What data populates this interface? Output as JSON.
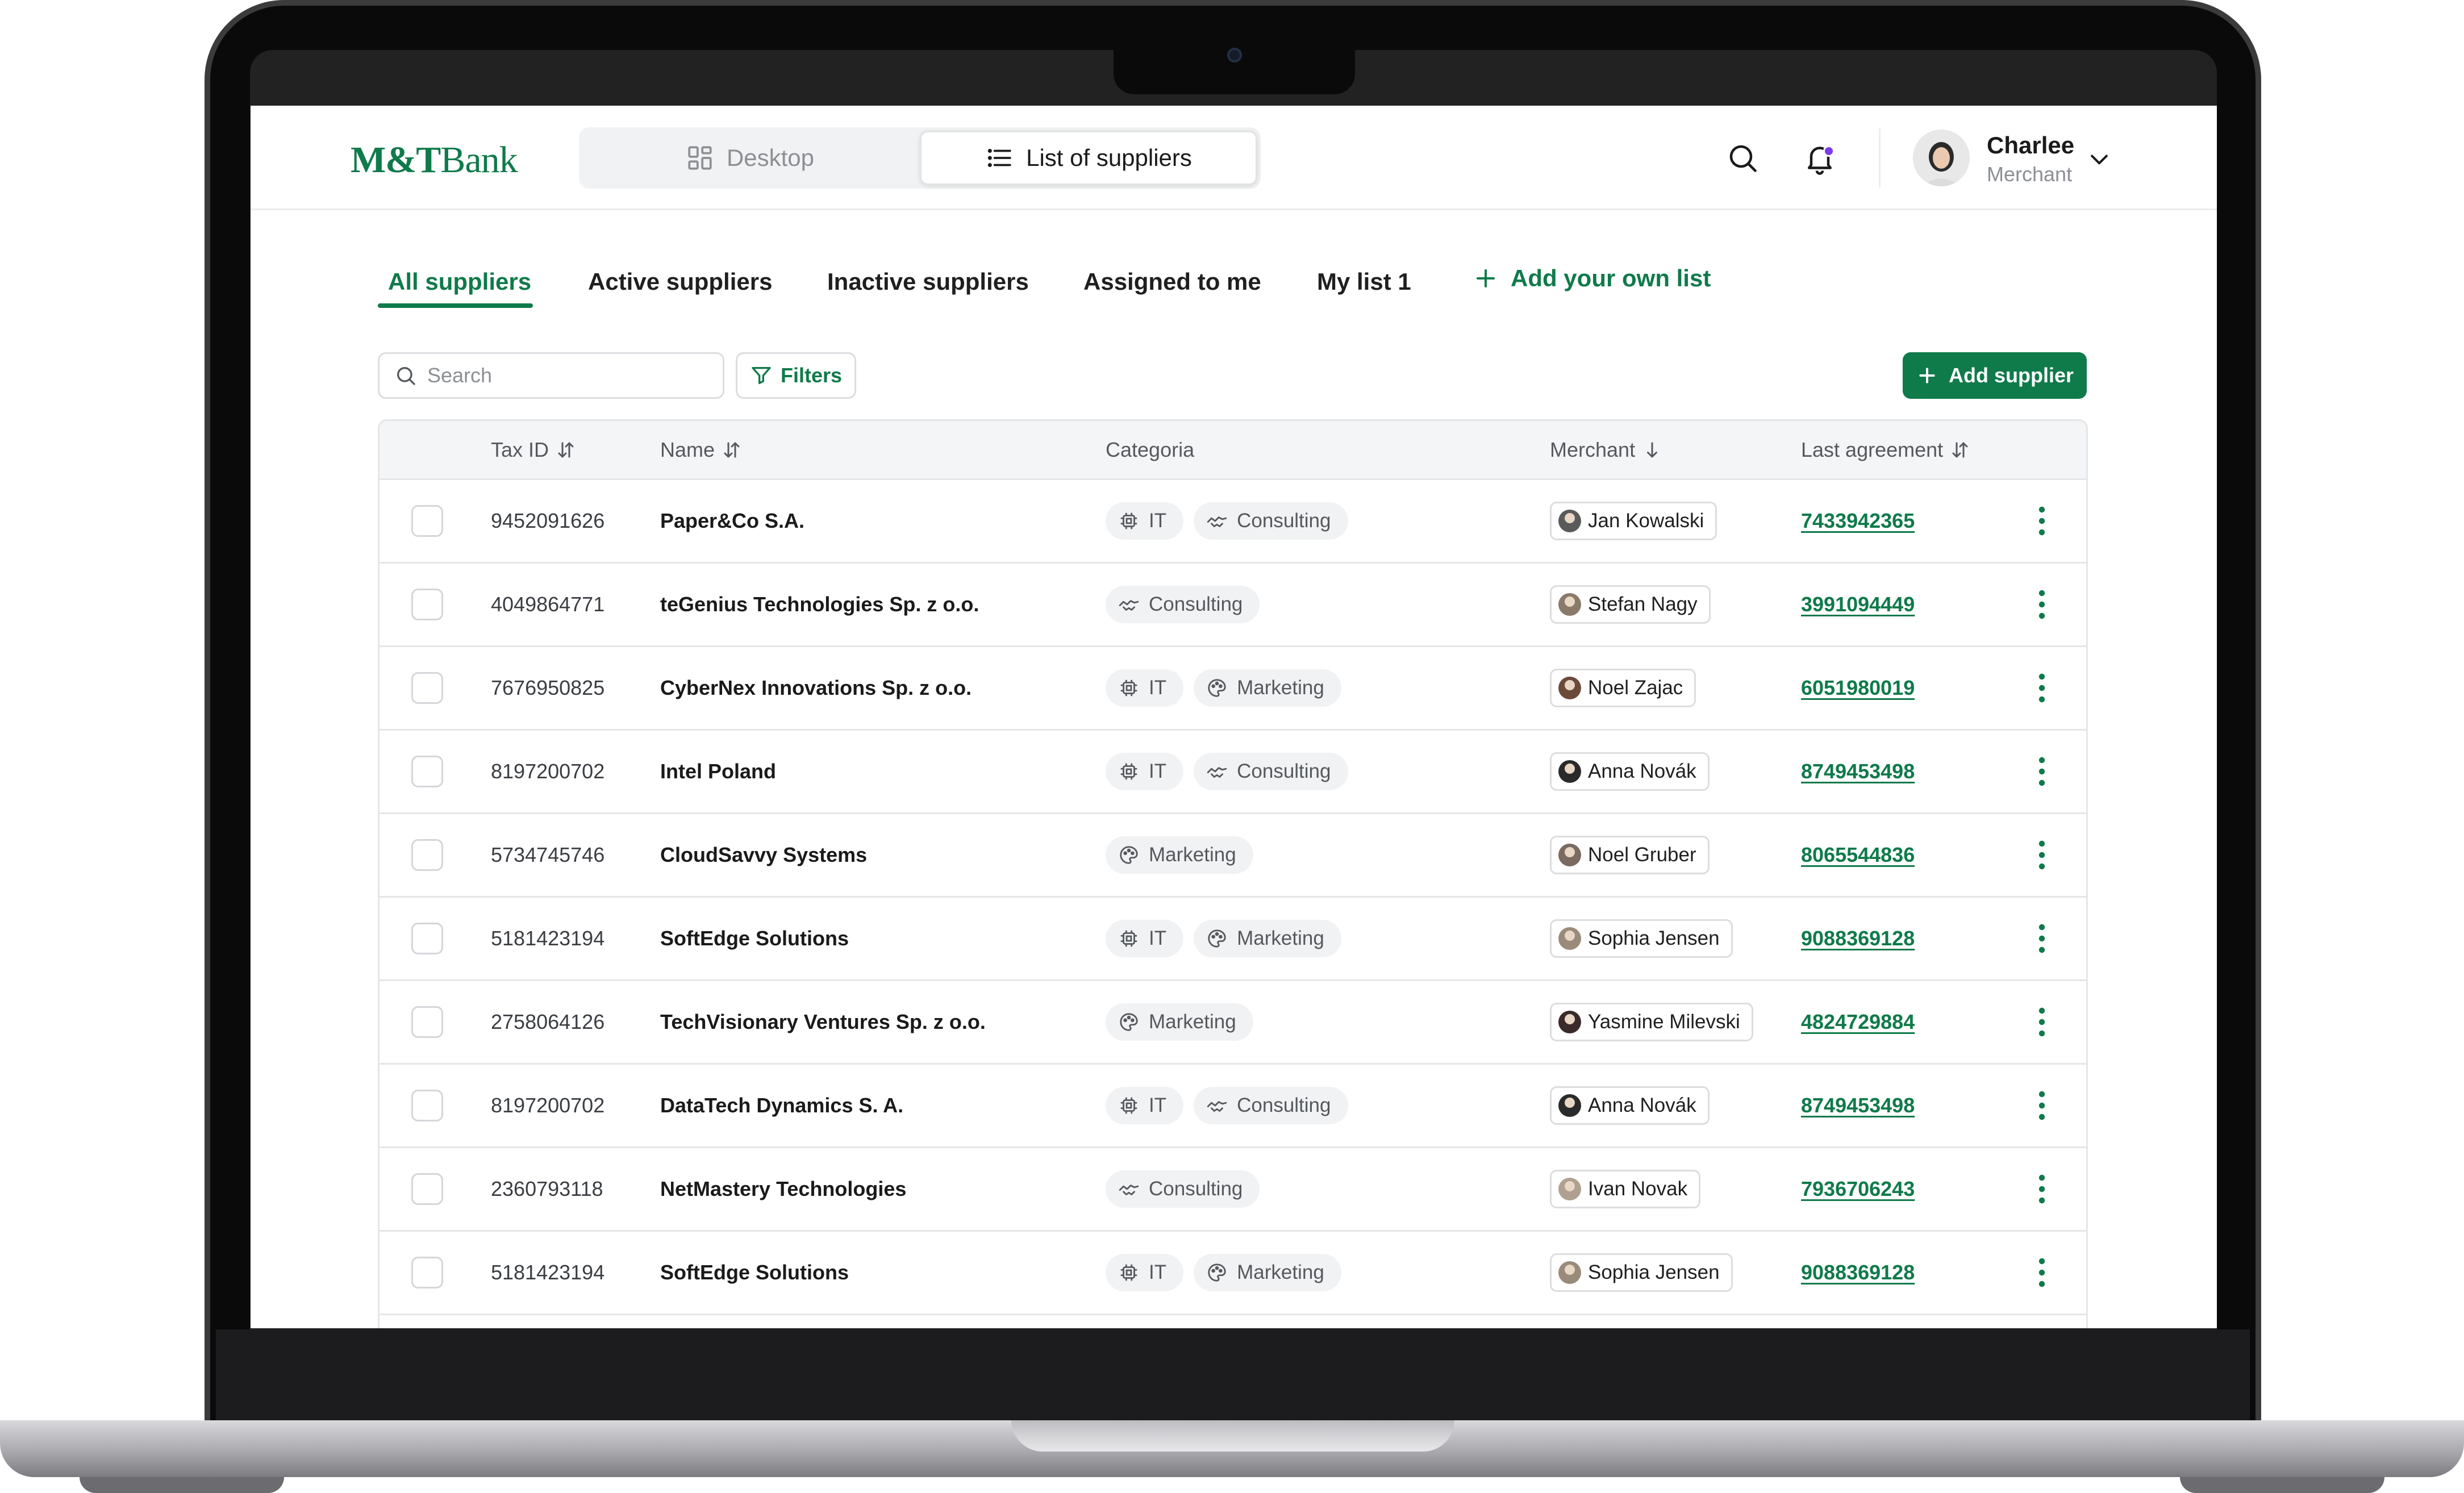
{
  "brand": {
    "logo_main": "M&T",
    "logo_suffix": "Bank",
    "accent": "#0f7a4a"
  },
  "view_switch": {
    "desktop_label": "Desktop",
    "list_label": "List of suppliers",
    "active": "list"
  },
  "user": {
    "name": "Charlee",
    "role": "Merchant",
    "notification_dot_color": "#7a3cf0"
  },
  "tabs": [
    {
      "label": "All suppliers",
      "active": true
    },
    {
      "label": "Active suppliers",
      "active": false
    },
    {
      "label": "Inactive suppliers",
      "active": false
    },
    {
      "label": "Assigned to me",
      "active": false
    },
    {
      "label": "My list 1",
      "active": false
    }
  ],
  "add_list_label": "Add your own list",
  "toolbar": {
    "search_placeholder": "Search",
    "filters_label": "Filters",
    "add_supplier_label": "Add supplier"
  },
  "table": {
    "columns": {
      "tax_id": "Tax ID",
      "name": "Name",
      "category": "Categoria",
      "merchant": "Merchant",
      "last_agreement": "Last agreement"
    },
    "rows": [
      {
        "tax_id": "9452091626",
        "name": "Paper&Co S.A.",
        "categories": [
          "IT",
          "Consulting"
        ],
        "merchant": "Jan Kowalski",
        "last_agreement": "7433942365"
      },
      {
        "tax_id": "4049864771",
        "name": "teGenius Technologies Sp. z o.o.",
        "categories": [
          "Consulting"
        ],
        "merchant": "Stefan Nagy",
        "last_agreement": "3991094449"
      },
      {
        "tax_id": "7676950825",
        "name": "CyberNex Innovations Sp. z o.o.",
        "categories": [
          "IT",
          "Marketing"
        ],
        "merchant": "Noel Zajac",
        "last_agreement": "6051980019"
      },
      {
        "tax_id": "8197200702",
        "name": "Intel Poland",
        "categories": [
          "IT",
          "Consulting"
        ],
        "merchant": "Anna Novák",
        "last_agreement": "8749453498"
      },
      {
        "tax_id": "5734745746",
        "name": "CloudSavvy Systems",
        "categories": [
          "Marketing"
        ],
        "merchant": "Noel Gruber",
        "last_agreement": "8065544836"
      },
      {
        "tax_id": "5181423194",
        "name": "SoftEdge Solutions",
        "categories": [
          "IT",
          "Marketing"
        ],
        "merchant": "Sophia Jensen",
        "last_agreement": "9088369128"
      },
      {
        "tax_id": "2758064126",
        "name": "TechVisionary Ventures Sp. z o.o.",
        "categories": [
          "Marketing"
        ],
        "merchant": "Yasmine Milevski",
        "last_agreement": "4824729884"
      },
      {
        "tax_id": "8197200702",
        "name": "DataTech Dynamics S. A.",
        "categories": [
          "IT",
          "Consulting"
        ],
        "merchant": "Anna Novák",
        "last_agreement": "8749453498"
      },
      {
        "tax_id": "2360793118",
        "name": "NetMastery Technologies",
        "categories": [
          "Consulting"
        ],
        "merchant": "Ivan Novak",
        "last_agreement": "7936706243"
      },
      {
        "tax_id": "5181423194",
        "name": "SoftEdge Solutions",
        "categories": [
          "IT",
          "Marketing"
        ],
        "merchant": "Sophia Jensen",
        "last_agreement": "9088369128"
      }
    ]
  },
  "icons": {
    "IT": "chip-icon",
    "Consulting": "handshake-icon",
    "Marketing": "palette-icon"
  }
}
